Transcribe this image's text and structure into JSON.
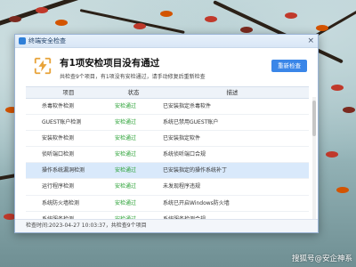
{
  "window": {
    "title": "终端安全检查",
    "close_icon": "close-icon"
  },
  "header": {
    "headline": "有1项安检项目没有通过",
    "subline": "共检查9个项目，有1项没有安检通过，请手动修复后重新检查",
    "recheck_label": "重新检查",
    "status_icon": "warning-bolt-icon",
    "accent": "#3a86e8",
    "warn_color": "#e8a33a"
  },
  "table": {
    "headers": [
      "项目",
      "状态",
      "描述"
    ],
    "rows": [
      {
        "item": "杀毒软件检测",
        "status": "安检通过",
        "desc": "已安装指定杀毒软件"
      },
      {
        "item": "GUEST账户检测",
        "status": "安检通过",
        "desc": "系统已禁用GUEST账户"
      },
      {
        "item": "安装软件检测",
        "status": "安检通过",
        "desc": "已安装指定软件"
      },
      {
        "item": "侦听端口检测",
        "status": "安检通过",
        "desc": "系统侦听端口合规"
      },
      {
        "item": "操作系统漏洞检测",
        "status": "安检通过",
        "desc": "已安装指定的操作系统补丁",
        "selected": true
      },
      {
        "item": "运行程序检测",
        "status": "安检通过",
        "desc": "未发现程序违规"
      },
      {
        "item": "系统防火墙检测",
        "status": "安检通过",
        "desc": "系统已开启Windows防火墙"
      },
      {
        "item": "系统服务检测",
        "status": "安检通过",
        "desc": "系统服务检测合规"
      }
    ],
    "status_color": "#27a033"
  },
  "footer": {
    "text": "检查时间:2023-04-27 10:03:37，共检查9个项目"
  },
  "watermark": {
    "text": "搜狐号@安企神系"
  }
}
